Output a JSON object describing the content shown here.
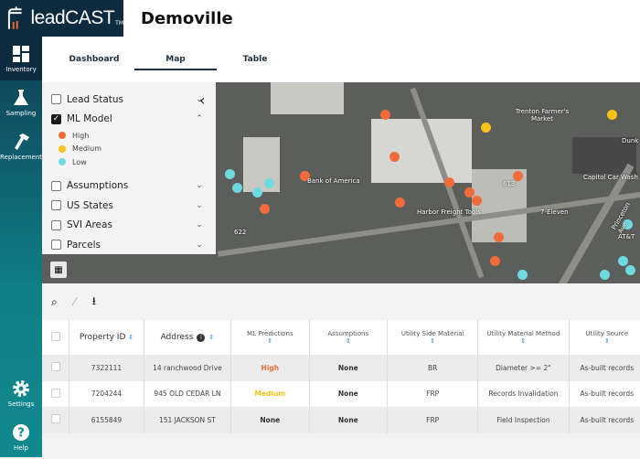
{
  "app": {
    "logo": "leadCAST",
    "tm": "TM",
    "title": "Demoville"
  },
  "nav": [
    {
      "label": "Inventory"
    },
    {
      "label": "Sampling"
    },
    {
      "label": "Replacement"
    },
    {
      "label": "Settings"
    },
    {
      "label": "Help"
    }
  ],
  "tabs": [
    "Dashboard",
    "Map",
    "Table"
  ],
  "layers": [
    {
      "label": "Lead Status",
      "checked": false
    },
    {
      "label": "ML Model",
      "checked": true
    },
    {
      "label": "Assumptions",
      "checked": false
    },
    {
      "label": "US States",
      "checked": false
    },
    {
      "label": "SVI Areas",
      "checked": false
    },
    {
      "label": "Parcels",
      "checked": false
    }
  ],
  "legend": [
    {
      "label": "High",
      "color": "#f26b3a"
    },
    {
      "label": "Medium",
      "color": "#f7c21a"
    },
    {
      "label": "Low",
      "color": "#6fd9e0"
    }
  ],
  "map_labels": [
    "Trenton Farmer's Market",
    "Bank of America",
    "Harbor Freight Tools",
    "7-Eleven",
    "Capitol Car Wash",
    "Dunk",
    "Princeton Ave",
    "613",
    "622",
    "AT&T"
  ],
  "table": {
    "headers": [
      "Property ID",
      "Address",
      "ML Predictions",
      "Assumptions",
      "Utility Side Material",
      "Utility Material Method",
      "Utility Source"
    ],
    "rows": [
      [
        "7322111",
        "14 ranchwood Drive",
        "High",
        "None",
        "BR",
        "Diameter >= 2\"",
        "As-built records"
      ],
      [
        "7204244",
        "945 OLD CEDAR LN",
        "Medium",
        "None",
        "FRP",
        "Records Invalidation",
        "As-built records"
      ],
      [
        "6155849",
        "151 JACKSON ST",
        "None",
        "None",
        "FRP",
        "Field Inspection",
        "As-built records"
      ]
    ]
  }
}
